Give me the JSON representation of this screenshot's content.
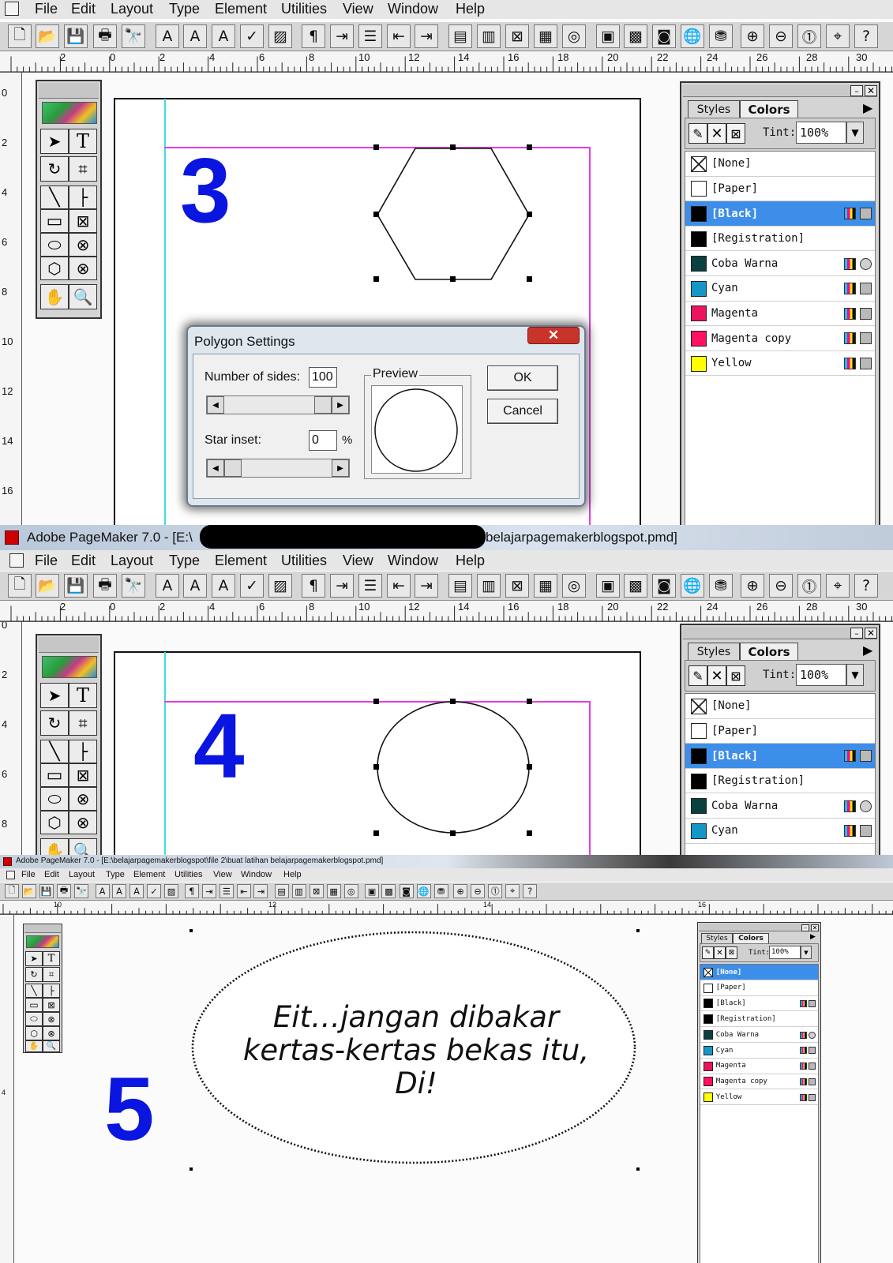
{
  "menu": {
    "file": "File",
    "edit": "Edit",
    "layout": "Layout",
    "type": "Type",
    "element": "Element",
    "utilities": "Utilities",
    "view": "View",
    "window": "Window",
    "help": "Help"
  },
  "ruler": {
    "ticks": [
      "2",
      "0",
      "2",
      "4",
      "6",
      "8",
      "10",
      "12",
      "14",
      "16",
      "18",
      "20",
      "22",
      "24",
      "26",
      "28",
      "30"
    ],
    "vticks": [
      "0",
      "2",
      "4",
      "6",
      "8",
      "10",
      "12",
      "14",
      "16"
    ]
  },
  "ruler3": {
    "ticks": [
      "10",
      "12",
      "14",
      "16"
    ],
    "vticks": [
      "4"
    ]
  },
  "palette": {
    "tab_styles": "Styles",
    "tab_colors": "Colors",
    "tint_label": "Tint:",
    "tint_value": "100%"
  },
  "colors": [
    "[None]",
    "[Paper]",
    "[Black]",
    "[Registration]",
    "Coba Warna",
    "Cyan",
    "Magenta",
    "Magenta copy",
    "Yellow"
  ],
  "step3": {
    "number": "3"
  },
  "dialog": {
    "title": "Polygon Settings",
    "sides_label": "Number of sides:",
    "sides_value": "100",
    "inset_label": "Star inset:",
    "inset_value": "0",
    "percent": "%",
    "preview_label": "Preview",
    "ok": "OK",
    "cancel": "Cancel"
  },
  "window2": {
    "title_left": "Adobe PageMaker 7.0 - [E:\\",
    "title_right": "belajarpagemakerblogspot.pmd]"
  },
  "step4": {
    "number": "4"
  },
  "window3": {
    "title": "Adobe PageMaker 7.0 - [E:\\belajarpagemakerblogspot\\file 2\\buat latihan belajarpagemakerblogspot.pmd]"
  },
  "step5": {
    "number": "5",
    "line1": "Eit…jangan dibakar",
    "line2": "kertas-kertas bekas itu,",
    "line3": "Di!"
  },
  "accent": {
    "step_number": "#0a15e0",
    "selection": "#3d8ee8",
    "margin_guide": "#e23de2",
    "column_guide": "#3ee0e0"
  },
  "swatches": {
    "none": "none",
    "paper": "#ffffff",
    "black": "#000000",
    "registration": "#000000",
    "coba_warna": "#0b4040",
    "cyan": "#1497c8",
    "magenta": "#ea1460",
    "magenta_copy": "#ff1060",
    "yellow": "#ffff00"
  }
}
